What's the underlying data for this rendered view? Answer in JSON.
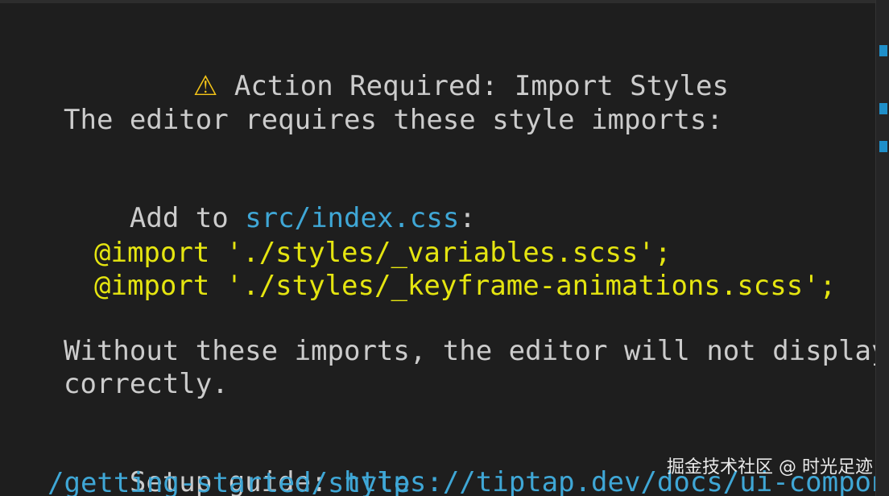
{
  "warning": {
    "icon": "warning-icon",
    "icon_glyph": "⚠",
    "title": "Action Required: Import Styles"
  },
  "message": {
    "intro": "The editor requires these style imports:",
    "add_to_prefix": "Add to ",
    "add_to_file": "src/index.css",
    "add_to_suffix": ":",
    "imports": [
      "@import './styles/_variables.scss';",
      "@import './styles/_keyframe-animations.scss';"
    ],
    "without_line1": "Without these imports, the editor will not display",
    "without_line2": "correctly.",
    "setup_prefix": "Setup guide: ",
    "setup_url_line1": "https://tiptap.dev/docs/ui-components",
    "setup_url_line2": "/getting-started/style"
  },
  "watermark": "掘金技术社区 @ 时光足迹",
  "colors": {
    "background": "#1e1e1e",
    "text": "#cccccc",
    "link": "#3fa7d6",
    "code": "#e5e510",
    "warning": "#f5c518",
    "scroll_marker": "#1f8fc9"
  }
}
